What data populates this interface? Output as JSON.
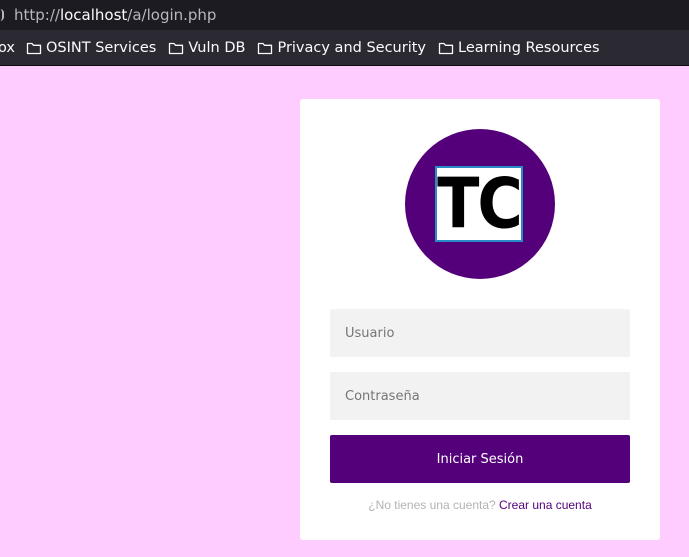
{
  "browser": {
    "url_prefix": "http://",
    "url_host": "localhost",
    "url_path": "/a/login.php",
    "bookmarks": [
      {
        "label": "ox"
      },
      {
        "label": "OSINT Services"
      },
      {
        "label": "Vuln DB"
      },
      {
        "label": "Privacy and Security"
      },
      {
        "label": "Learning Resources"
      }
    ]
  },
  "login": {
    "logo_text": "TC",
    "username_placeholder": "Usuario",
    "password_placeholder": "Contraseña",
    "submit_label": "Iniciar Sesión",
    "signup_prompt": "¿No tienes una cuenta?",
    "signup_link": "Crear una cuenta"
  },
  "colors": {
    "page_background": "#ffccff",
    "brand": "#53007a",
    "logo_border": "#2a8cc6"
  }
}
